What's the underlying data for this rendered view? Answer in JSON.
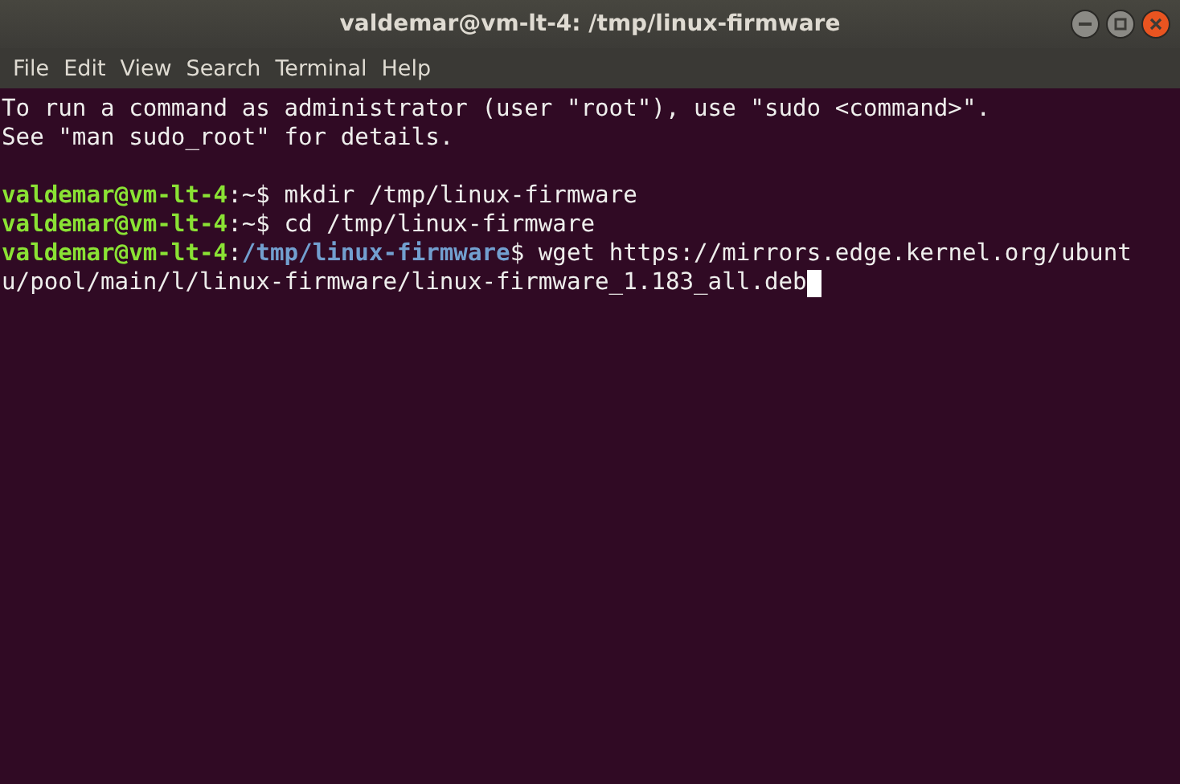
{
  "window": {
    "title": "valdemar@vm-lt-4: /tmp/linux-firmware",
    "controls": [
      {
        "kind": "minimize"
      },
      {
        "kind": "maximize"
      },
      {
        "kind": "close"
      }
    ]
  },
  "menu": [
    "File",
    "Edit",
    "View",
    "Search",
    "Terminal",
    "Help"
  ],
  "terminal": {
    "lines": [
      {
        "kind": "text",
        "segments": [
          {
            "kind": "plain",
            "text": "To run a command as administrator (user \"root\"), use \"sudo <command>\"."
          }
        ]
      },
      {
        "kind": "text",
        "segments": [
          {
            "kind": "plain",
            "text": "See \"man sudo_root\" for details."
          }
        ]
      },
      {
        "kind": "blank"
      },
      {
        "kind": "text",
        "segments": [
          {
            "kind": "user",
            "text": "valdemar@vm-lt-4"
          },
          {
            "kind": "plain",
            "text": ":~$ mkdir /tmp/linux-firmware"
          }
        ]
      },
      {
        "kind": "text",
        "segments": [
          {
            "kind": "user",
            "text": "valdemar@vm-lt-4"
          },
          {
            "kind": "plain",
            "text": ":~$ cd /tmp/linux-firmware"
          }
        ]
      },
      {
        "kind": "text",
        "segments": [
          {
            "kind": "user",
            "text": "valdemar@vm-lt-4"
          },
          {
            "kind": "plain",
            "text": ":"
          },
          {
            "kind": "path",
            "text": "/tmp/linux-firmware"
          },
          {
            "kind": "plain",
            "text": "$ wget https://mirrors.edge.kernel.org/ubunt"
          }
        ]
      },
      {
        "kind": "text",
        "cursor": true,
        "segments": [
          {
            "kind": "plain",
            "text": "u/pool/main/l/linux-firmware/linux-firmware_1.183_all.deb"
          }
        ]
      }
    ]
  }
}
